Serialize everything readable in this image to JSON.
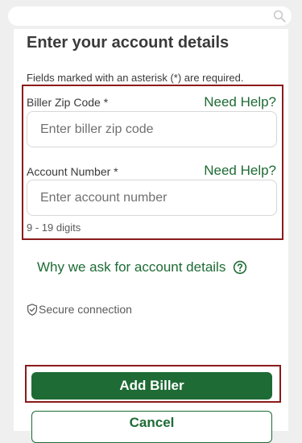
{
  "search": {
    "icon": "search-icon"
  },
  "form": {
    "title": "Enter your account details",
    "required_note": "Fields marked with an asterisk (*) are required.",
    "zip_field": {
      "label": "Biller Zip Code *",
      "help": "Need Help?",
      "placeholder": "Enter biller zip code",
      "value": ""
    },
    "account_field": {
      "label": "Account Number *",
      "help": "Need Help?",
      "placeholder": "Enter account number",
      "value": "",
      "hint": "9 - 19 digits"
    },
    "why_link": "Why we ask for account details",
    "secure_text": "Secure connection",
    "add_button": "Add Biller",
    "cancel_button": "Cancel"
  },
  "colors": {
    "brand_green": "#1e6b35",
    "highlight_red": "#8b1a1a",
    "background": "#efefef"
  }
}
